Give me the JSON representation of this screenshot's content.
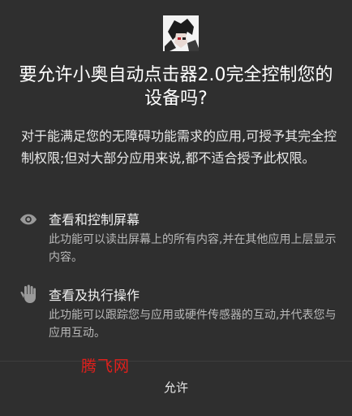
{
  "dialog": {
    "title": "要允许小奥自动点击器2.0完全控制您的设备吗?",
    "description": "对于能满足您的无障碍功能需求的应用,可授予其完全控制权限;但对大部分应用来说,都不适合授予此权限。"
  },
  "permissions": [
    {
      "icon": "eye-icon",
      "title": "查看和控制屏幕",
      "description": "此功能可以读出屏幕上的所有内容,并在其他应用上层显示内容。"
    },
    {
      "icon": "hand-icon",
      "title": "查看及执行操作",
      "description": "此功能可以跟踪您与应用或硬件传感器的互动,并代表您与应用互动。"
    }
  ],
  "watermark": "腾飞网",
  "buttons": {
    "allow_label": "允许"
  },
  "colors": {
    "background": "#2f2f2f",
    "watermark": "#e0201c",
    "icon": "#9a9a9a"
  }
}
